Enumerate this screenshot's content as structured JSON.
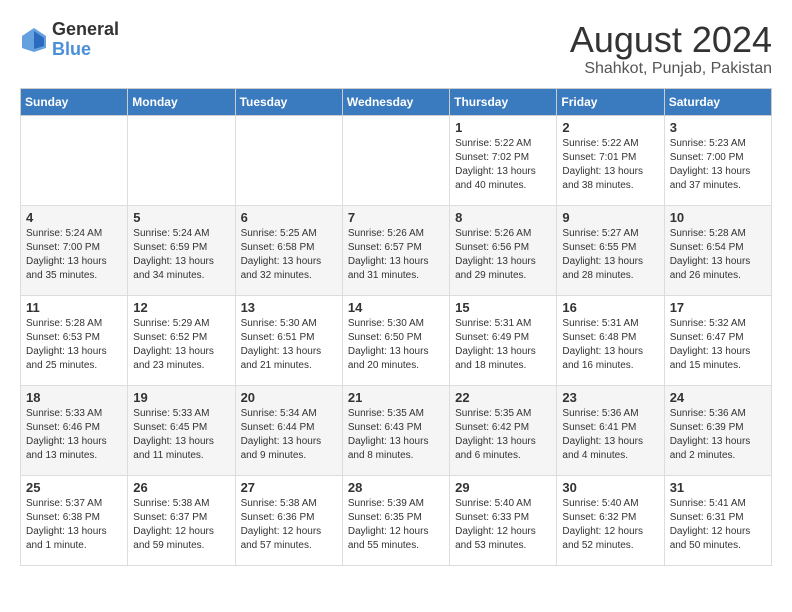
{
  "logo": {
    "general": "General",
    "blue": "Blue"
  },
  "title": "August 2024",
  "subtitle": "Shahkot, Punjab, Pakistan",
  "days_of_week": [
    "Sunday",
    "Monday",
    "Tuesday",
    "Wednesday",
    "Thursday",
    "Friday",
    "Saturday"
  ],
  "weeks": [
    [
      {
        "day": "",
        "info": ""
      },
      {
        "day": "",
        "info": ""
      },
      {
        "day": "",
        "info": ""
      },
      {
        "day": "",
        "info": ""
      },
      {
        "day": "1",
        "info": "Sunrise: 5:22 AM\nSunset: 7:02 PM\nDaylight: 13 hours\nand 40 minutes."
      },
      {
        "day": "2",
        "info": "Sunrise: 5:22 AM\nSunset: 7:01 PM\nDaylight: 13 hours\nand 38 minutes."
      },
      {
        "day": "3",
        "info": "Sunrise: 5:23 AM\nSunset: 7:00 PM\nDaylight: 13 hours\nand 37 minutes."
      }
    ],
    [
      {
        "day": "4",
        "info": "Sunrise: 5:24 AM\nSunset: 7:00 PM\nDaylight: 13 hours\nand 35 minutes."
      },
      {
        "day": "5",
        "info": "Sunrise: 5:24 AM\nSunset: 6:59 PM\nDaylight: 13 hours\nand 34 minutes."
      },
      {
        "day": "6",
        "info": "Sunrise: 5:25 AM\nSunset: 6:58 PM\nDaylight: 13 hours\nand 32 minutes."
      },
      {
        "day": "7",
        "info": "Sunrise: 5:26 AM\nSunset: 6:57 PM\nDaylight: 13 hours\nand 31 minutes."
      },
      {
        "day": "8",
        "info": "Sunrise: 5:26 AM\nSunset: 6:56 PM\nDaylight: 13 hours\nand 29 minutes."
      },
      {
        "day": "9",
        "info": "Sunrise: 5:27 AM\nSunset: 6:55 PM\nDaylight: 13 hours\nand 28 minutes."
      },
      {
        "day": "10",
        "info": "Sunrise: 5:28 AM\nSunset: 6:54 PM\nDaylight: 13 hours\nand 26 minutes."
      }
    ],
    [
      {
        "day": "11",
        "info": "Sunrise: 5:28 AM\nSunset: 6:53 PM\nDaylight: 13 hours\nand 25 minutes."
      },
      {
        "day": "12",
        "info": "Sunrise: 5:29 AM\nSunset: 6:52 PM\nDaylight: 13 hours\nand 23 minutes."
      },
      {
        "day": "13",
        "info": "Sunrise: 5:30 AM\nSunset: 6:51 PM\nDaylight: 13 hours\nand 21 minutes."
      },
      {
        "day": "14",
        "info": "Sunrise: 5:30 AM\nSunset: 6:50 PM\nDaylight: 13 hours\nand 20 minutes."
      },
      {
        "day": "15",
        "info": "Sunrise: 5:31 AM\nSunset: 6:49 PM\nDaylight: 13 hours\nand 18 minutes."
      },
      {
        "day": "16",
        "info": "Sunrise: 5:31 AM\nSunset: 6:48 PM\nDaylight: 13 hours\nand 16 minutes."
      },
      {
        "day": "17",
        "info": "Sunrise: 5:32 AM\nSunset: 6:47 PM\nDaylight: 13 hours\nand 15 minutes."
      }
    ],
    [
      {
        "day": "18",
        "info": "Sunrise: 5:33 AM\nSunset: 6:46 PM\nDaylight: 13 hours\nand 13 minutes."
      },
      {
        "day": "19",
        "info": "Sunrise: 5:33 AM\nSunset: 6:45 PM\nDaylight: 13 hours\nand 11 minutes."
      },
      {
        "day": "20",
        "info": "Sunrise: 5:34 AM\nSunset: 6:44 PM\nDaylight: 13 hours\nand 9 minutes."
      },
      {
        "day": "21",
        "info": "Sunrise: 5:35 AM\nSunset: 6:43 PM\nDaylight: 13 hours\nand 8 minutes."
      },
      {
        "day": "22",
        "info": "Sunrise: 5:35 AM\nSunset: 6:42 PM\nDaylight: 13 hours\nand 6 minutes."
      },
      {
        "day": "23",
        "info": "Sunrise: 5:36 AM\nSunset: 6:41 PM\nDaylight: 13 hours\nand 4 minutes."
      },
      {
        "day": "24",
        "info": "Sunrise: 5:36 AM\nSunset: 6:39 PM\nDaylight: 13 hours\nand 2 minutes."
      }
    ],
    [
      {
        "day": "25",
        "info": "Sunrise: 5:37 AM\nSunset: 6:38 PM\nDaylight: 13 hours\nand 1 minute."
      },
      {
        "day": "26",
        "info": "Sunrise: 5:38 AM\nSunset: 6:37 PM\nDaylight: 12 hours\nand 59 minutes."
      },
      {
        "day": "27",
        "info": "Sunrise: 5:38 AM\nSunset: 6:36 PM\nDaylight: 12 hours\nand 57 minutes."
      },
      {
        "day": "28",
        "info": "Sunrise: 5:39 AM\nSunset: 6:35 PM\nDaylight: 12 hours\nand 55 minutes."
      },
      {
        "day": "29",
        "info": "Sunrise: 5:40 AM\nSunset: 6:33 PM\nDaylight: 12 hours\nand 53 minutes."
      },
      {
        "day": "30",
        "info": "Sunrise: 5:40 AM\nSunset: 6:32 PM\nDaylight: 12 hours\nand 52 minutes."
      },
      {
        "day": "31",
        "info": "Sunrise: 5:41 AM\nSunset: 6:31 PM\nDaylight: 12 hours\nand 50 minutes."
      }
    ]
  ]
}
